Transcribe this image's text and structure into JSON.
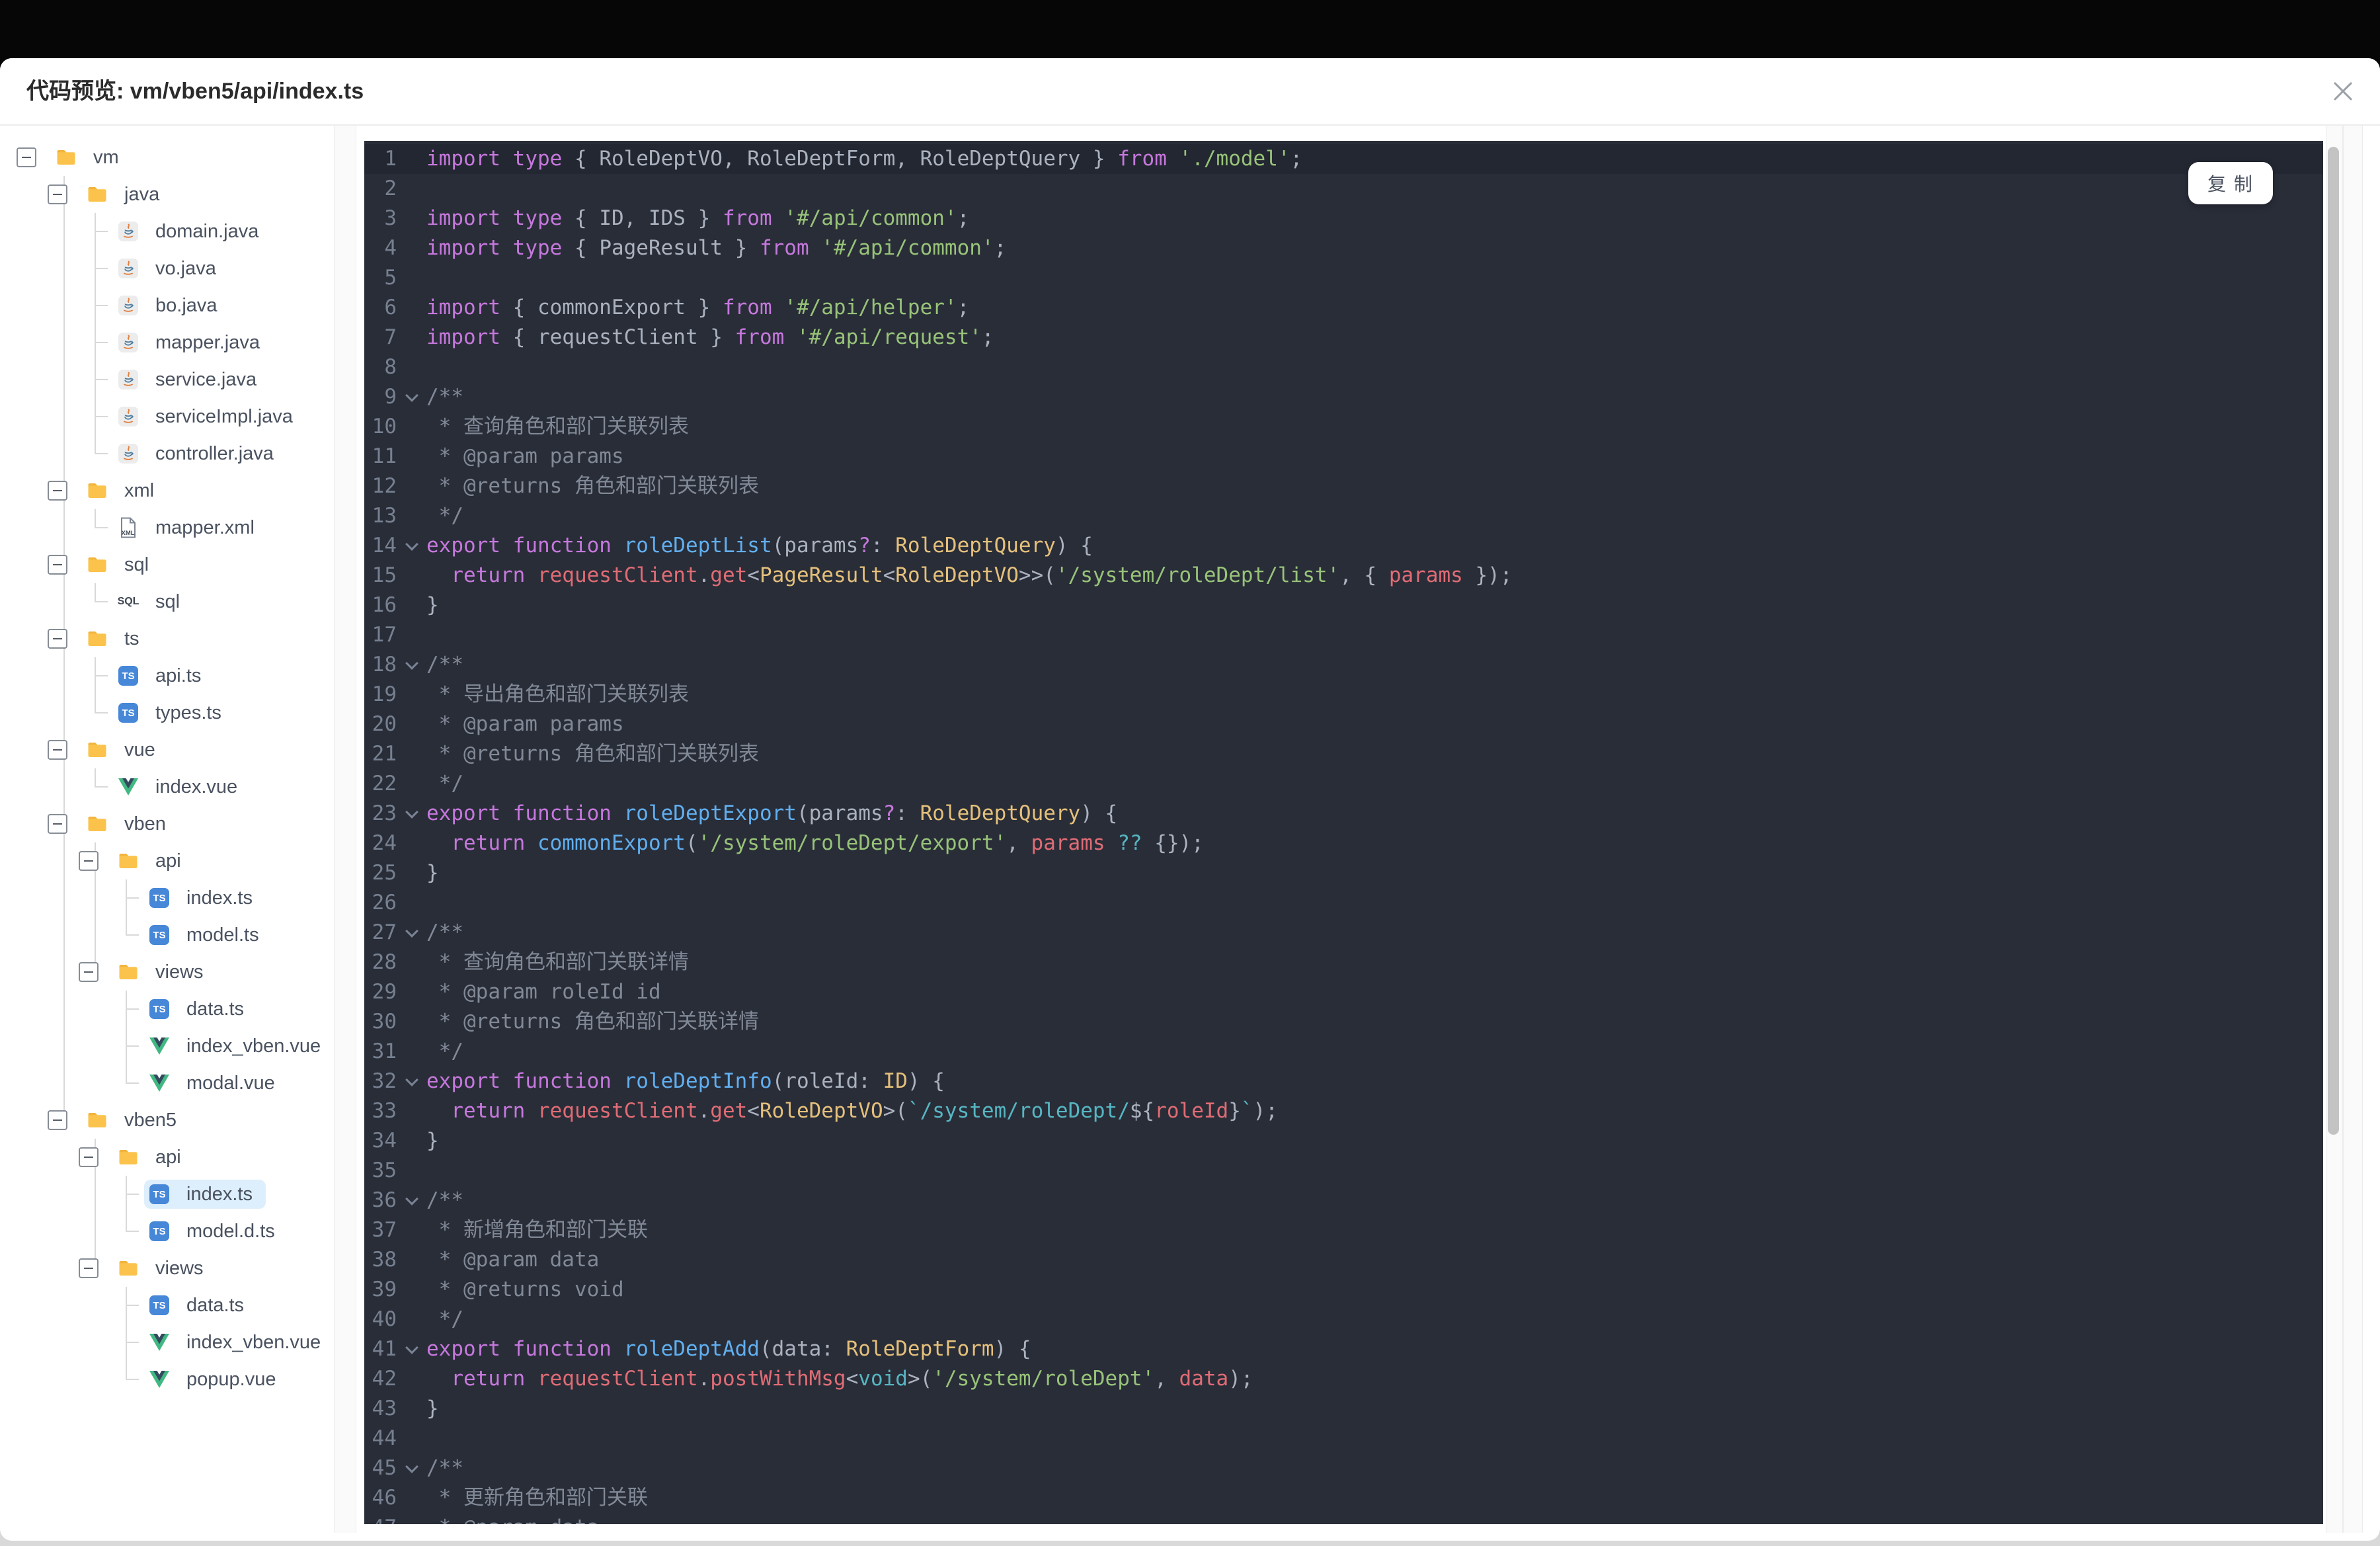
{
  "window": {
    "title": "代码预览: vm/vben5/api/index.ts",
    "copy_label": "复 制",
    "close_icon": "close-x"
  },
  "colors": {
    "code_bg": "#292d38",
    "active_line_bg": "#232731",
    "selected_item_bg": "#ddeefc",
    "keyword": "#c678dd",
    "identifier": "#abb2bf",
    "function": "#61afef",
    "type": "#e5c07b",
    "string": "#98c379",
    "template_string": "#56b6c2",
    "property": "#e06c75",
    "comment": "#818997",
    "folder_icon": "#fbc34c",
    "ts_icon": "#4687d8",
    "vue_icon_green": "#41b883",
    "vue_icon_dark": "#34495e"
  },
  "tree": {
    "nodes": [
      {
        "label": "vm",
        "type": "folder",
        "depth": 0,
        "toggle": true
      },
      {
        "label": "java",
        "type": "folder",
        "depth": 1,
        "toggle": true
      },
      {
        "label": "domain.java",
        "type": "java",
        "depth": 2
      },
      {
        "label": "vo.java",
        "type": "java",
        "depth": 2
      },
      {
        "label": "bo.java",
        "type": "java",
        "depth": 2
      },
      {
        "label": "mapper.java",
        "type": "java",
        "depth": 2
      },
      {
        "label": "service.java",
        "type": "java",
        "depth": 2
      },
      {
        "label": "serviceImpl.java",
        "type": "java",
        "depth": 2
      },
      {
        "label": "controller.java",
        "type": "java",
        "depth": 2
      },
      {
        "label": "xml",
        "type": "folder",
        "depth": 1,
        "toggle": true
      },
      {
        "label": "mapper.xml",
        "type": "xml",
        "depth": 2
      },
      {
        "label": "sql",
        "type": "folder",
        "depth": 1,
        "toggle": true
      },
      {
        "label": "sql",
        "type": "sql",
        "depth": 2
      },
      {
        "label": "ts",
        "type": "folder",
        "depth": 1,
        "toggle": true
      },
      {
        "label": "api.ts",
        "type": "ts",
        "depth": 2
      },
      {
        "label": "types.ts",
        "type": "ts",
        "depth": 2
      },
      {
        "label": "vue",
        "type": "folder",
        "depth": 1,
        "toggle": true
      },
      {
        "label": "index.vue",
        "type": "vue",
        "depth": 2
      },
      {
        "label": "vben",
        "type": "folder",
        "depth": 1,
        "toggle": true
      },
      {
        "label": "api",
        "type": "folder",
        "depth": 2,
        "toggle": true
      },
      {
        "label": "index.ts",
        "type": "ts",
        "depth": 3
      },
      {
        "label": "model.ts",
        "type": "ts",
        "depth": 3
      },
      {
        "label": "views",
        "type": "folder",
        "depth": 2,
        "toggle": true
      },
      {
        "label": "data.ts",
        "type": "ts",
        "depth": 3
      },
      {
        "label": "index_vben.vue",
        "type": "vue",
        "depth": 3
      },
      {
        "label": "modal.vue",
        "type": "vue",
        "depth": 3
      },
      {
        "label": "vben5",
        "type": "folder",
        "depth": 1,
        "toggle": true
      },
      {
        "label": "api",
        "type": "folder",
        "depth": 2,
        "toggle": true
      },
      {
        "label": "index.ts",
        "type": "ts",
        "depth": 3,
        "selected": true
      },
      {
        "label": "model.d.ts",
        "type": "ts",
        "depth": 3
      },
      {
        "label": "views",
        "type": "folder",
        "depth": 2,
        "toggle": true
      },
      {
        "label": "data.ts",
        "type": "ts",
        "depth": 3
      },
      {
        "label": "index_vben.vue",
        "type": "vue",
        "depth": 3
      },
      {
        "label": "popup.vue",
        "type": "vue",
        "depth": 3
      }
    ]
  },
  "code": {
    "lines": [
      {
        "a": true,
        "t": [
          [
            "k",
            "import"
          ],
          [
            "p",
            " "
          ],
          [
            "k",
            "type"
          ],
          [
            "p",
            " { "
          ],
          [
            "i",
            "RoleDeptVO"
          ],
          [
            "p",
            ", "
          ],
          [
            "i",
            "RoleDeptForm"
          ],
          [
            "p",
            ", "
          ],
          [
            "i",
            "RoleDeptQuery"
          ],
          [
            "p",
            " } "
          ],
          [
            "k",
            "from"
          ],
          [
            "p",
            " "
          ],
          [
            "s",
            "'./model'"
          ],
          [
            "p",
            ";"
          ]
        ]
      },
      {
        "t": []
      },
      {
        "t": [
          [
            "k",
            "import"
          ],
          [
            "p",
            " "
          ],
          [
            "k",
            "type"
          ],
          [
            "p",
            " { "
          ],
          [
            "i",
            "ID"
          ],
          [
            "p",
            ", "
          ],
          [
            "i",
            "IDS"
          ],
          [
            "p",
            " } "
          ],
          [
            "k",
            "from"
          ],
          [
            "p",
            " "
          ],
          [
            "s",
            "'#/api/common'"
          ],
          [
            "p",
            ";"
          ]
        ]
      },
      {
        "t": [
          [
            "k",
            "import"
          ],
          [
            "p",
            " "
          ],
          [
            "k",
            "type"
          ],
          [
            "p",
            " { "
          ],
          [
            "i",
            "PageResult"
          ],
          [
            "p",
            " } "
          ],
          [
            "k",
            "from"
          ],
          [
            "p",
            " "
          ],
          [
            "s",
            "'#/api/common'"
          ],
          [
            "p",
            ";"
          ]
        ]
      },
      {
        "t": []
      },
      {
        "t": [
          [
            "k",
            "import"
          ],
          [
            "p",
            " { "
          ],
          [
            "i",
            "commonExport"
          ],
          [
            "p",
            " } "
          ],
          [
            "k",
            "from"
          ],
          [
            "p",
            " "
          ],
          [
            "s",
            "'#/api/helper'"
          ],
          [
            "p",
            ";"
          ]
        ]
      },
      {
        "t": [
          [
            "k",
            "import"
          ],
          [
            "p",
            " { "
          ],
          [
            "i",
            "requestClient"
          ],
          [
            "p",
            " } "
          ],
          [
            "k",
            "from"
          ],
          [
            "p",
            " "
          ],
          [
            "s",
            "'#/api/request'"
          ],
          [
            "p",
            ";"
          ]
        ]
      },
      {
        "t": []
      },
      {
        "f": true,
        "t": [
          [
            "c",
            "/**"
          ]
        ]
      },
      {
        "t": [
          [
            "c",
            " * 查询角色和部门关联列表"
          ]
        ]
      },
      {
        "t": [
          [
            "c",
            " * @param params"
          ]
        ]
      },
      {
        "t": [
          [
            "c",
            " * @returns 角色和部门关联列表"
          ]
        ]
      },
      {
        "t": [
          [
            "c",
            " */"
          ]
        ]
      },
      {
        "f": true,
        "t": [
          [
            "k",
            "export"
          ],
          [
            "p",
            " "
          ],
          [
            "k",
            "function"
          ],
          [
            "p",
            " "
          ],
          [
            "f",
            "roleDeptList"
          ],
          [
            "p",
            "("
          ],
          [
            "i",
            "params"
          ],
          [
            "k",
            "?"
          ],
          [
            "p",
            ": "
          ],
          [
            "t",
            "RoleDeptQuery"
          ],
          [
            "p",
            ") {"
          ]
        ]
      },
      {
        "t": [
          [
            "p",
            "  "
          ],
          [
            "k",
            "return"
          ],
          [
            "p",
            " "
          ],
          [
            "r",
            "requestClient"
          ],
          [
            "p",
            "."
          ],
          [
            "r",
            "get"
          ],
          [
            "p",
            "<"
          ],
          [
            "t",
            "PageResult"
          ],
          [
            "p",
            "<"
          ],
          [
            "t",
            "RoleDeptVO"
          ],
          [
            "p",
            ">>("
          ],
          [
            "s",
            "'/system/roleDept/list'"
          ],
          [
            "p",
            ", { "
          ],
          [
            "r",
            "params"
          ],
          [
            "p",
            " });"
          ]
        ]
      },
      {
        "t": [
          [
            "p",
            "}"
          ]
        ]
      },
      {
        "t": []
      },
      {
        "f": true,
        "t": [
          [
            "c",
            "/**"
          ]
        ]
      },
      {
        "t": [
          [
            "c",
            " * 导出角色和部门关联列表"
          ]
        ]
      },
      {
        "t": [
          [
            "c",
            " * @param params"
          ]
        ]
      },
      {
        "t": [
          [
            "c",
            " * @returns 角色和部门关联列表"
          ]
        ]
      },
      {
        "t": [
          [
            "c",
            " */"
          ]
        ]
      },
      {
        "f": true,
        "t": [
          [
            "k",
            "export"
          ],
          [
            "p",
            " "
          ],
          [
            "k",
            "function"
          ],
          [
            "p",
            " "
          ],
          [
            "f",
            "roleDeptExport"
          ],
          [
            "p",
            "("
          ],
          [
            "i",
            "params"
          ],
          [
            "k",
            "?"
          ],
          [
            "p",
            ": "
          ],
          [
            "t",
            "RoleDeptQuery"
          ],
          [
            "p",
            ") {"
          ]
        ]
      },
      {
        "t": [
          [
            "p",
            "  "
          ],
          [
            "k",
            "return"
          ],
          [
            "p",
            " "
          ],
          [
            "f",
            "commonExport"
          ],
          [
            "p",
            "("
          ],
          [
            "s",
            "'/system/roleDept/export'"
          ],
          [
            "p",
            ", "
          ],
          [
            "r",
            "params"
          ],
          [
            "p",
            " "
          ],
          [
            "o",
            "??"
          ],
          [
            "p",
            " {});"
          ]
        ]
      },
      {
        "t": [
          [
            "p",
            "}"
          ]
        ]
      },
      {
        "t": []
      },
      {
        "f": true,
        "t": [
          [
            "c",
            "/**"
          ]
        ]
      },
      {
        "t": [
          [
            "c",
            " * 查询角色和部门关联详情"
          ]
        ]
      },
      {
        "t": [
          [
            "c",
            " * @param roleId id"
          ]
        ]
      },
      {
        "t": [
          [
            "c",
            " * @returns 角色和部门关联详情"
          ]
        ]
      },
      {
        "t": [
          [
            "c",
            " */"
          ]
        ]
      },
      {
        "f": true,
        "t": [
          [
            "k",
            "export"
          ],
          [
            "p",
            " "
          ],
          [
            "k",
            "function"
          ],
          [
            "p",
            " "
          ],
          [
            "f",
            "roleDeptInfo"
          ],
          [
            "p",
            "("
          ],
          [
            "i",
            "roleId"
          ],
          [
            "p",
            ": "
          ],
          [
            "t",
            "ID"
          ],
          [
            "p",
            ") {"
          ]
        ]
      },
      {
        "t": [
          [
            "p",
            "  "
          ],
          [
            "k",
            "return"
          ],
          [
            "p",
            " "
          ],
          [
            "r",
            "requestClient"
          ],
          [
            "p",
            "."
          ],
          [
            "r",
            "get"
          ],
          [
            "p",
            "<"
          ],
          [
            "t",
            "RoleDeptVO"
          ],
          [
            "p",
            ">("
          ],
          [
            "m",
            "`/system/roleDept/"
          ],
          [
            "p",
            "${"
          ],
          [
            "r",
            "roleId"
          ],
          [
            "p",
            "}"
          ],
          [
            "m",
            "`"
          ],
          [
            "p",
            ");"
          ]
        ]
      },
      {
        "t": [
          [
            "p",
            "}"
          ]
        ]
      },
      {
        "t": []
      },
      {
        "f": true,
        "t": [
          [
            "c",
            "/**"
          ]
        ]
      },
      {
        "t": [
          [
            "c",
            " * 新增角色和部门关联"
          ]
        ]
      },
      {
        "t": [
          [
            "c",
            " * @param data"
          ]
        ]
      },
      {
        "t": [
          [
            "c",
            " * @returns void"
          ]
        ]
      },
      {
        "t": [
          [
            "c",
            " */"
          ]
        ]
      },
      {
        "f": true,
        "t": [
          [
            "k",
            "export"
          ],
          [
            "p",
            " "
          ],
          [
            "k",
            "function"
          ],
          [
            "p",
            " "
          ],
          [
            "f",
            "roleDeptAdd"
          ],
          [
            "p",
            "("
          ],
          [
            "i",
            "data"
          ],
          [
            "p",
            ": "
          ],
          [
            "t",
            "RoleDeptForm"
          ],
          [
            "p",
            ") {"
          ]
        ]
      },
      {
        "t": [
          [
            "p",
            "  "
          ],
          [
            "k",
            "return"
          ],
          [
            "p",
            " "
          ],
          [
            "r",
            "requestClient"
          ],
          [
            "p",
            "."
          ],
          [
            "r",
            "postWithMsg"
          ],
          [
            "p",
            "<"
          ],
          [
            "o",
            "void"
          ],
          [
            "p",
            ">("
          ],
          [
            "s",
            "'/system/roleDept'"
          ],
          [
            "p",
            ", "
          ],
          [
            "r",
            "data"
          ],
          [
            "p",
            ");"
          ]
        ]
      },
      {
        "t": [
          [
            "p",
            "}"
          ]
        ]
      },
      {
        "t": []
      },
      {
        "f": true,
        "t": [
          [
            "c",
            "/**"
          ]
        ]
      },
      {
        "t": [
          [
            "c",
            " * 更新角色和部门关联"
          ]
        ]
      },
      {
        "t": [
          [
            "c",
            " * @param data"
          ]
        ]
      }
    ]
  }
}
